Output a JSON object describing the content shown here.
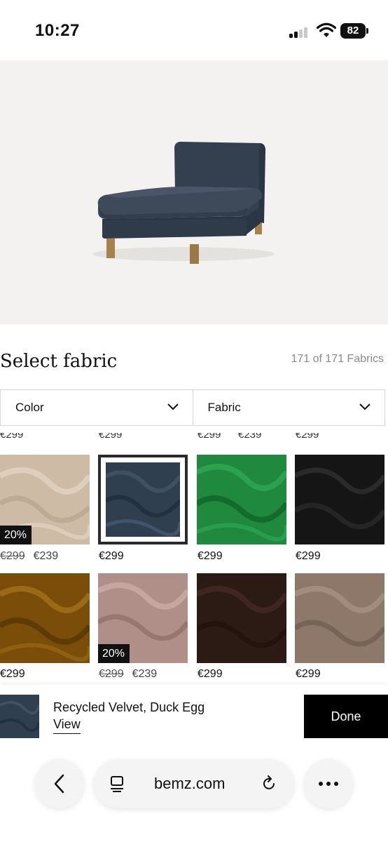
{
  "status_bar": {
    "time": "10:27",
    "battery": "82"
  },
  "hero": {
    "product": "chaise-longue-sofa"
  },
  "fabric_panel": {
    "title": "Select fabric",
    "count": "171 of 171 Fabrics",
    "filters": {
      "color_label": "Color",
      "fabric_label": "Fabric"
    }
  },
  "swatches": [
    {
      "name": "beige-velvet",
      "color": "#cdbba6",
      "badge": "20%",
      "old_price": "€299",
      "price": "€239"
    },
    {
      "name": "duck-egg-velvet",
      "color": "#2f3f4f",
      "price": "€299",
      "selected": true
    },
    {
      "name": "green-velvet",
      "color": "#1f8a3e",
      "price": "€299"
    },
    {
      "name": "black-velvet",
      "color": "#151515",
      "price": "€299"
    },
    {
      "name": "ochre-velvet",
      "color": "#7a4e08",
      "price": "€299"
    },
    {
      "name": "dusty-pink-velvet",
      "color": "#b08f88",
      "badge": "20%",
      "old_price": "€299",
      "price": "€239"
    },
    {
      "name": "chocolate-velvet",
      "color": "#2c1a14",
      "price": "€299"
    },
    {
      "name": "taupe-velvet",
      "color": "#8d7869",
      "price": "€299"
    }
  ],
  "selection": {
    "name": "Recycled Velvet, Duck Egg",
    "view_label": "View",
    "done_label": "Done"
  },
  "browser": {
    "url": "bemz.com"
  }
}
